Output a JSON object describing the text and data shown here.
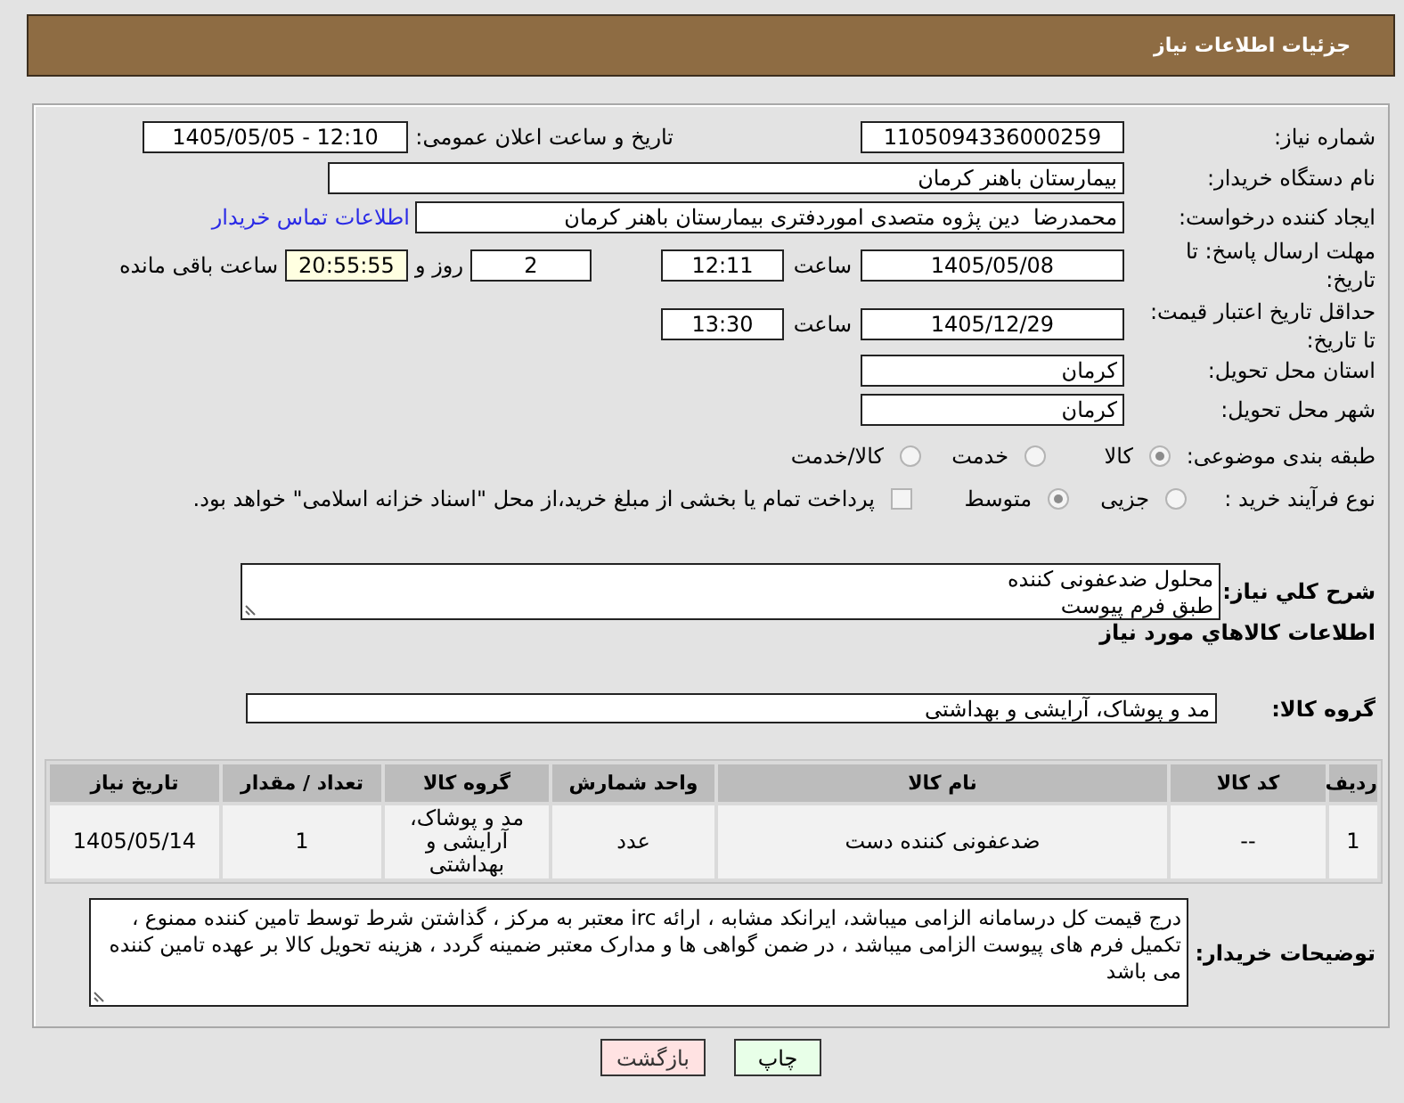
{
  "header": {
    "title": "جزئیات اطلاعات نیاز"
  },
  "fields": {
    "need_number": {
      "label": "شماره نیاز:",
      "value": "1105094336000259"
    },
    "announce_datetime": {
      "label": "تاریخ و ساعت اعلان عمومی:",
      "value": "1405/05/05 - 12:10"
    },
    "buyer_org": {
      "label": "نام دستگاه خریدار:",
      "value": "بیمارستان باهنر کرمان"
    },
    "requester": {
      "label": "ایجاد کننده درخواست:",
      "value": "محمدرضا  دین پژوه متصدی اموردفتری بیمارستان باهنر کرمان",
      "link": "اطلاعات تماس خریدار"
    },
    "response_deadline": {
      "label": "مهلت ارسال پاسخ: تا تاریخ:",
      "date": "1405/05/08",
      "time_label": "ساعت",
      "time": "12:11",
      "days": "2",
      "days_label": "روز و",
      "remaining": "20:55:55",
      "remaining_label": "ساعت باقی مانده"
    },
    "price_validity": {
      "label": "حداقل تاریخ اعتبار قیمت: تا تاریخ:",
      "date": "1405/12/29",
      "time_label": "ساعت",
      "time": "13:30"
    },
    "province": {
      "label": "استان محل تحویل:",
      "value": "کرمان"
    },
    "city": {
      "label": "شهر محل تحویل:",
      "value": "کرمان"
    }
  },
  "classification": {
    "label": "طبقه بندی موضوعی:",
    "options": [
      {
        "label": "کالا",
        "selected": true
      },
      {
        "label": "خدمت",
        "selected": false
      },
      {
        "label": "کالا/خدمت",
        "selected": false
      }
    ]
  },
  "process": {
    "label": "نوع فرآیند خرید :",
    "options": [
      {
        "label": "جزیی",
        "selected": false
      },
      {
        "label": "متوسط",
        "selected": true
      }
    ],
    "treasury": {
      "label": "پرداخت تمام یا بخشی از مبلغ خرید،از محل \"اسناد خزانه اسلامی\" خواهد بود.",
      "checked": false
    }
  },
  "description": {
    "label": "شرح کلي نياز:",
    "value": "محلول ضدعفونی کننده\nطبق فرم پیوست"
  },
  "goods_title": "اطلاعات کالاهاي مورد نياز",
  "goods_group": {
    "label": "گروه کالا:",
    "value": "مد و پوشاک، آرایشی و بهداشتی"
  },
  "table": {
    "columns": [
      "ردیف",
      "کد کالا",
      "نام کالا",
      "واحد شمارش",
      "گروه کالا",
      "تعداد / مقدار",
      "تاریخ نیاز"
    ],
    "rows": [
      [
        "1",
        "--",
        "ضدعفونی کننده دست",
        "عدد",
        "مد و پوشاک، آرایشی و بهداشتی",
        "1",
        "1405/05/14"
      ]
    ]
  },
  "buyer_notes": {
    "label": "توضیحات خریدار:",
    "value": "درج قیمت کل درسامانه الزامی میباشد، ایرانکد مشابه ، ارائه irc معتبر به مرکز ، گذاشتن شرط توسط تامین کننده ممنوع ، تکمیل فرم های پیوست الزامی میباشد ، در ضمن گواهی ها و مدارک معتبر ضمینه گردد ، هزینه تحویل کالا بر عهده تامین کننده می باشد"
  },
  "buttons": [
    {
      "label": "چاپ",
      "kind": "print"
    },
    {
      "label": "بازگشت",
      "kind": "back"
    }
  ]
}
